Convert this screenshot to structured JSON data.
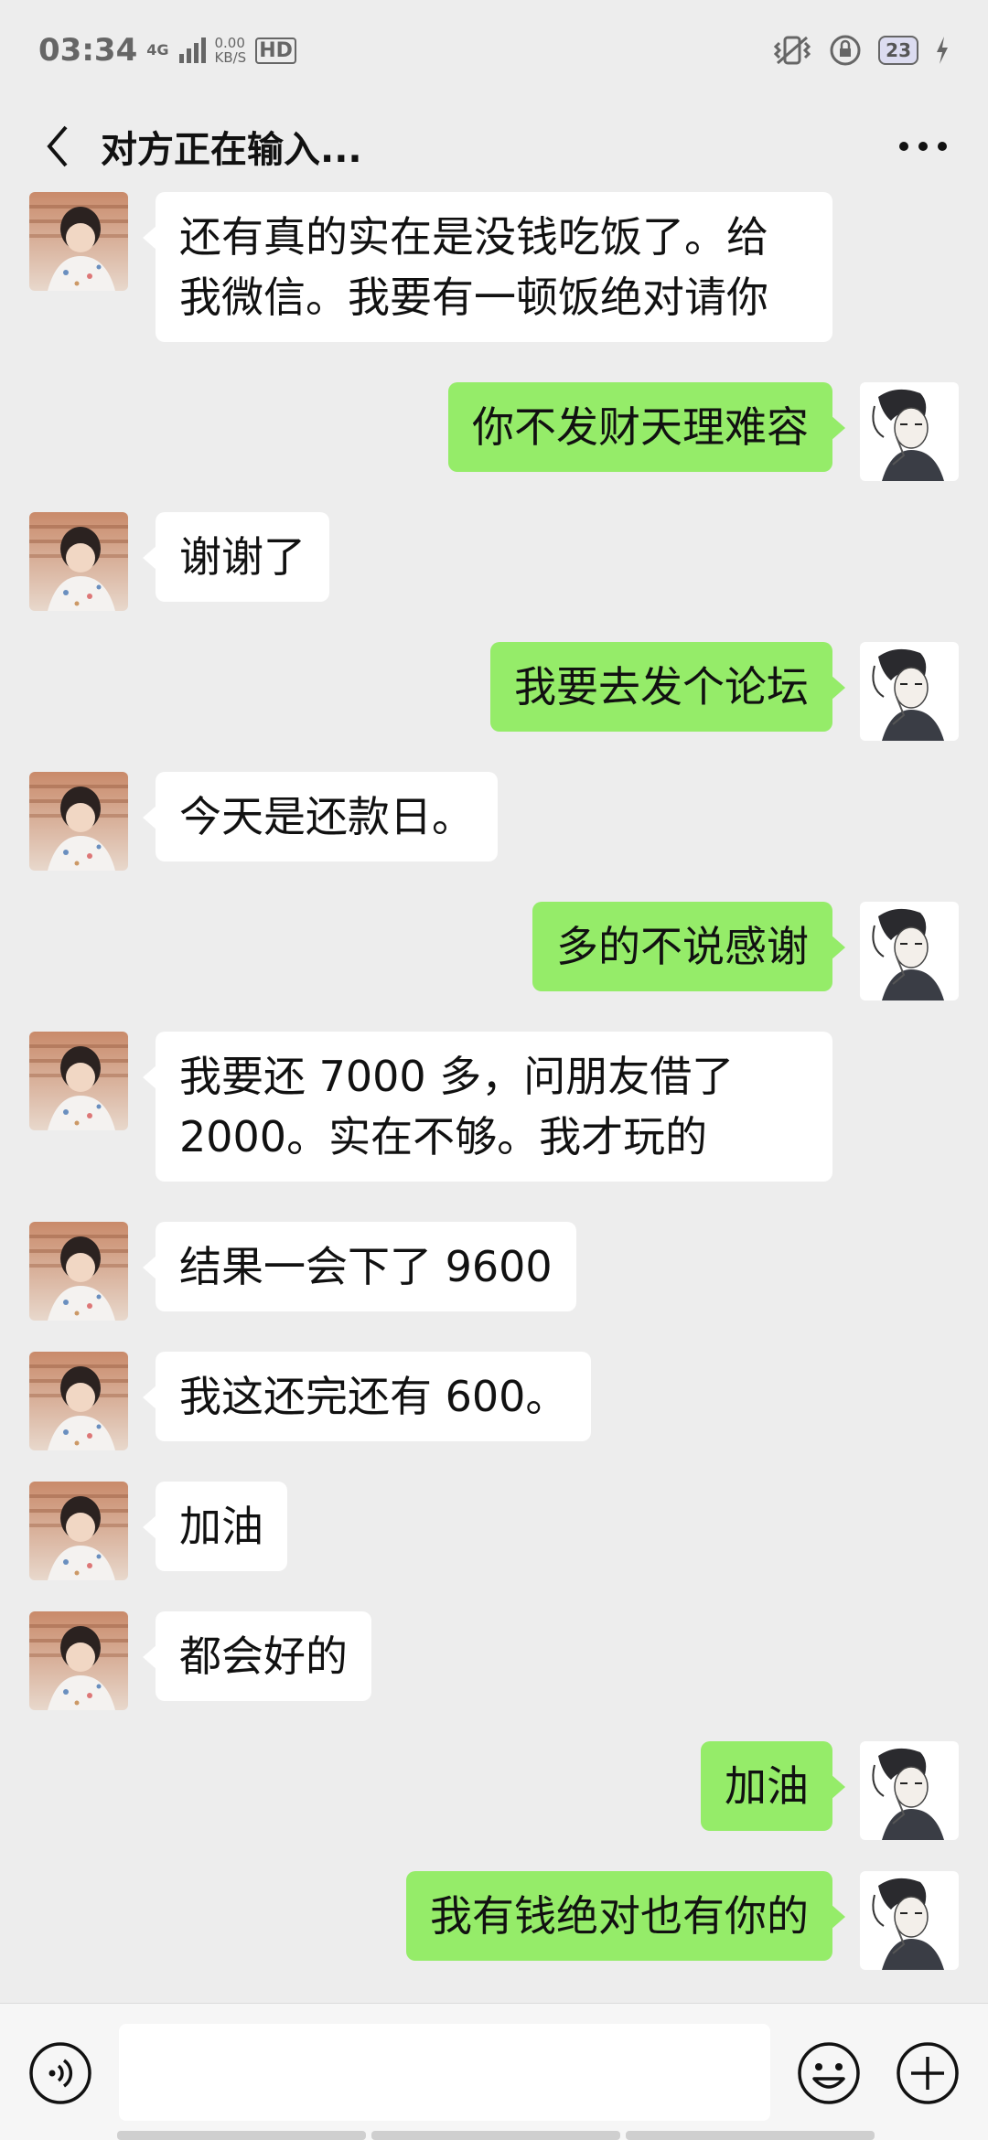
{
  "status_bar": {
    "time": "03:34",
    "network": "4G",
    "net_speed_value": "0.00",
    "net_speed_unit": "KB/S",
    "hd": "HD",
    "battery": "23"
  },
  "header": {
    "title": "对方正在输入..."
  },
  "messages": [
    {
      "side": "left",
      "text": "还有真的实在是没钱吃饭了。给我微信。我要有一顿饭绝对请你"
    },
    {
      "side": "right",
      "text": "你不发财天理难容"
    },
    {
      "side": "left",
      "text": "谢谢了"
    },
    {
      "side": "right",
      "text": "我要去发个论坛"
    },
    {
      "side": "left",
      "text": "今天是还款日。"
    },
    {
      "side": "right",
      "text": "多的不说感谢"
    },
    {
      "side": "left",
      "text": "我要还 7000 多，问朋友借了 2000。实在不够。我才玩的"
    },
    {
      "side": "left",
      "text": "结果一会下了 9600"
    },
    {
      "side": "left",
      "text": "我这还完还有 600。"
    },
    {
      "side": "left",
      "text": "加油"
    },
    {
      "side": "left",
      "text": "都会好的"
    },
    {
      "side": "right",
      "text": "加油"
    },
    {
      "side": "right",
      "text": "我有钱绝对也有你的"
    }
  ],
  "input": {
    "value": ""
  },
  "colors": {
    "background": "#ededed",
    "sent_bubble": "#95ec69",
    "received_bubble": "#ffffff"
  }
}
